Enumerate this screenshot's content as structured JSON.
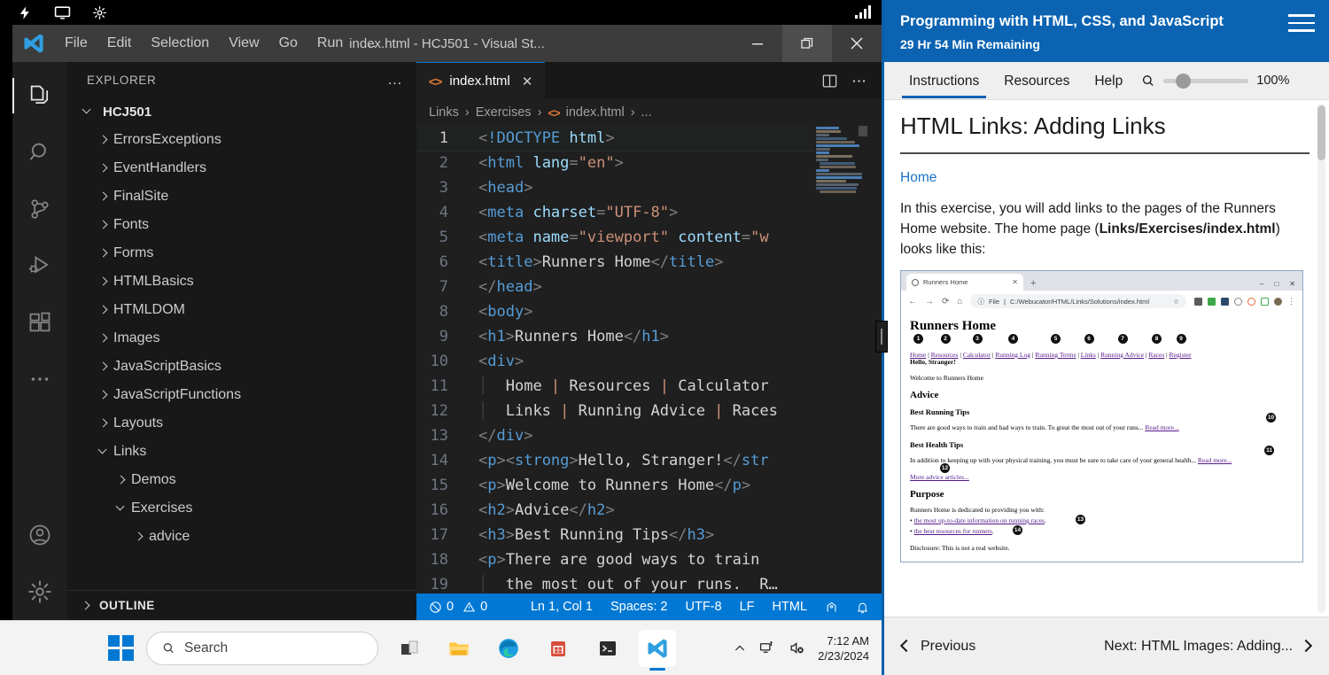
{
  "system_strip": {
    "icons": [
      "bolt-icon",
      "monitor-icon",
      "gear-icon",
      "signal-icon"
    ]
  },
  "vscode": {
    "window_title": "index.html - HCJ501 - Visual St...",
    "menu": [
      "File",
      "Edit",
      "Selection",
      "View",
      "Go",
      "Run",
      "…"
    ],
    "window_buttons": {
      "minimize": "—",
      "restore": "❐",
      "close": "✕"
    },
    "activity_bar": [
      {
        "name": "explorer-icon",
        "active": true
      },
      {
        "name": "search-icon",
        "active": false
      },
      {
        "name": "source-control-icon",
        "active": false
      },
      {
        "name": "run-debug-icon",
        "active": false
      },
      {
        "name": "extensions-icon",
        "active": false
      },
      {
        "name": "more-views-icon",
        "active": false
      },
      {
        "name": "account-icon",
        "active": false
      },
      {
        "name": "manage-settings-icon",
        "active": false
      }
    ],
    "sidebar": {
      "header": "EXPLORER",
      "header_actions": "…",
      "root": "HCJ501",
      "tree": [
        {
          "label": "ErrorsExceptions",
          "depth": 1,
          "expanded": false
        },
        {
          "label": "EventHandlers",
          "depth": 1,
          "expanded": false
        },
        {
          "label": "FinalSite",
          "depth": 1,
          "expanded": false
        },
        {
          "label": "Fonts",
          "depth": 1,
          "expanded": false
        },
        {
          "label": "Forms",
          "depth": 1,
          "expanded": false
        },
        {
          "label": "HTMLBasics",
          "depth": 1,
          "expanded": false
        },
        {
          "label": "HTMLDOM",
          "depth": 1,
          "expanded": false
        },
        {
          "label": "Images",
          "depth": 1,
          "expanded": false
        },
        {
          "label": "JavaScriptBasics",
          "depth": 1,
          "expanded": false
        },
        {
          "label": "JavaScriptFunctions",
          "depth": 1,
          "expanded": false
        },
        {
          "label": "Layouts",
          "depth": 1,
          "expanded": false
        },
        {
          "label": "Links",
          "depth": 1,
          "expanded": true
        },
        {
          "label": "Demos",
          "depth": 2,
          "expanded": false
        },
        {
          "label": "Exercises",
          "depth": 2,
          "expanded": true
        },
        {
          "label": "advice",
          "depth": 3,
          "expanded": false
        }
      ],
      "outline": "OUTLINE"
    },
    "editor": {
      "tab_label": "index.html",
      "tab_close": "✕",
      "tab_actions": [
        "split-editor-icon",
        "more-actions-icon"
      ],
      "breadcrumb": [
        "Links",
        "Exercises",
        "index.html",
        "..."
      ],
      "breadcrumb_separator": "›",
      "lines": [
        {
          "n": "1",
          "html": "<span class='t-punct'>&lt;</span><span class='t-doct'>!DOCTYPE </span><span class='t-docta'>html</span><span class='t-punct'>&gt;</span>"
        },
        {
          "n": "2",
          "html": "<span class='t-punct'>&lt;</span><span class='t-tag'>html</span> <span class='t-attr'>lang</span><span class='t-punct'>=</span><span class='t-str'>\"en\"</span><span class='t-punct'>&gt;</span>"
        },
        {
          "n": "3",
          "html": "<span class='t-punct'>&lt;</span><span class='t-tag'>head</span><span class='t-punct'>&gt;</span>"
        },
        {
          "n": "4",
          "html": "<span class='t-punct'>&lt;</span><span class='t-tag'>meta</span> <span class='t-attr'>charset</span><span class='t-punct'>=</span><span class='t-str'>\"UTF-8\"</span><span class='t-punct'>&gt;</span>"
        },
        {
          "n": "5",
          "html": "<span class='t-punct'>&lt;</span><span class='t-tag'>meta</span> <span class='t-attr'>name</span><span class='t-punct'>=</span><span class='t-str'>\"viewport\"</span> <span class='t-attr'>content</span><span class='t-punct'>=</span><span class='t-str'>\"w</span>"
        },
        {
          "n": "6",
          "html": "<span class='t-punct'>&lt;</span><span class='t-tag'>title</span><span class='t-punct'>&gt;</span><span class='t-txt'>Runners Home</span><span class='t-punct'>&lt;/</span><span class='t-tag'>title</span><span class='t-punct'>&gt;</span>"
        },
        {
          "n": "7",
          "html": "<span class='t-punct'>&lt;/</span><span class='t-tag'>head</span><span class='t-punct'>&gt;</span>"
        },
        {
          "n": "8",
          "html": "<span class='t-punct'>&lt;</span><span class='t-tag'>body</span><span class='t-punct'>&gt;</span>"
        },
        {
          "n": "9",
          "html": "<span class='t-punct'>&lt;</span><span class='t-tag'>h1</span><span class='t-punct'>&gt;</span><span class='t-txt'>Runners Home</span><span class='t-punct'>&lt;/</span><span class='t-tag'>h1</span><span class='t-punct'>&gt;</span>"
        },
        {
          "n": "10",
          "html": "<span class='t-punct'>&lt;</span><span class='t-tag'>div</span><span class='t-punct'>&gt;</span>"
        },
        {
          "n": "11",
          "html": "<span class='indent-guide'>│</span>  <span class='t-txt'>Home </span><span class='t-str'>|</span><span class='t-txt'> Resources </span><span class='t-str'>|</span><span class='t-txt'> Calculator</span>"
        },
        {
          "n": "12",
          "html": "<span class='indent-guide'>│</span>  <span class='t-txt'>Links </span><span class='t-str'>|</span><span class='t-txt'> Running Advice </span><span class='t-str'>|</span><span class='t-txt'> Races</span>"
        },
        {
          "n": "13",
          "html": "<span class='t-punct'>&lt;/</span><span class='t-tag'>div</span><span class='t-punct'>&gt;</span>"
        },
        {
          "n": "14",
          "html": "<span class='t-punct'>&lt;</span><span class='t-tag'>p</span><span class='t-punct'>&gt;&lt;</span><span class='t-tag'>strong</span><span class='t-punct'>&gt;</span><span class='t-txt'>Hello, Stranger!</span><span class='t-punct'>&lt;/</span><span class='t-tag'>str</span>"
        },
        {
          "n": "15",
          "html": "<span class='t-punct'>&lt;</span><span class='t-tag'>p</span><span class='t-punct'>&gt;</span><span class='t-txt'>Welcome to Runners Home</span><span class='t-punct'>&lt;/</span><span class='t-tag'>p</span><span class='t-punct'>&gt;</span>"
        },
        {
          "n": "16",
          "html": "<span class='t-punct'>&lt;</span><span class='t-tag'>h2</span><span class='t-punct'>&gt;</span><span class='t-txt'>Advice</span><span class='t-punct'>&lt;/</span><span class='t-tag'>h2</span><span class='t-punct'>&gt;</span>"
        },
        {
          "n": "17",
          "html": "<span class='t-punct'>&lt;</span><span class='t-tag'>h3</span><span class='t-punct'>&gt;</span><span class='t-txt'>Best Running Tips</span><span class='t-punct'>&lt;/</span><span class='t-tag'>h3</span><span class='t-punct'>&gt;</span>"
        },
        {
          "n": "18",
          "html": "<span class='t-punct'>&lt;</span><span class='t-tag'>p</span><span class='t-punct'>&gt;</span><span class='t-txt'>There are good ways to train</span>"
        },
        {
          "n": "19",
          "html": "<span class='indent-guide'>│</span>  <span class='t-txt'>the most out of your runs.  R…</span>"
        }
      ]
    },
    "status_bar": {
      "errors": "0",
      "warnings": "0",
      "position": "Ln 1, Col 1",
      "spaces": "Spaces: 2",
      "encoding": "UTF-8",
      "eol": "LF",
      "language": "HTML",
      "right_icons": [
        "remote-icon",
        "bell-icon"
      ]
    }
  },
  "taskbar": {
    "search_placeholder": "Search",
    "apps": [
      "start-icon",
      "task-view-icon",
      "file-explorer-icon",
      "edge-icon",
      "microsoft-store-icon",
      "terminal-icon",
      "vscode-icon"
    ],
    "tray_icons": [
      "show-hidden-icons-icon",
      "network-icon",
      "volume-muted-icon"
    ],
    "time": "7:12 AM",
    "date": "2/23/2024"
  },
  "course_panel": {
    "title": "Programming with HTML, CSS, and JavaScript",
    "time_remaining": "29 Hr 54 Min Remaining",
    "menu_icon": "hamburger-menu-icon",
    "tabs": [
      {
        "label": "Instructions",
        "active": true
      },
      {
        "label": "Resources",
        "active": false
      },
      {
        "label": "Help",
        "active": false
      }
    ],
    "zoom": {
      "icon": "search-icon",
      "percent": "100%"
    },
    "doc": {
      "heading": "HTML Links: Adding Links",
      "link": "Home",
      "paragraph_1": "In this exercise, you will add links to the pages of the Runners Home website. The home page (",
      "paragraph_1_bold": "Links/Exercises/index.html",
      "paragraph_1_end": ") looks like this:"
    },
    "embedded_browser": {
      "tab_title": "Runners Home",
      "new_tab": "+",
      "window_buttons": [
        "minimize",
        "maximize",
        "close"
      ],
      "nav_icons": [
        "back-icon",
        "forward-icon",
        "reload-icon",
        "home-icon"
      ],
      "url_prefix": "File",
      "url": "C:/Webucator/HTML/Links/Solutions/index.html",
      "omnibox_icons": [
        "star-icon",
        "extensions",
        "profile-icon",
        "more-menu-icon"
      ],
      "page": {
        "h1": "Runners Home",
        "nav_links": [
          "Home",
          "Resources",
          "Calculator",
          "Running Log",
          "Running Terms",
          "Links",
          "Running Advice",
          "Races",
          "Register"
        ],
        "nav_badges": [
          "1",
          "2",
          "3",
          "4",
          "5",
          "6",
          "7",
          "8",
          "9"
        ],
        "greeting": "Hello, Stranger!",
        "welcome": "Welcome to Runners Home",
        "h2_advice": "Advice",
        "h3_running": "Best Running Tips",
        "p_running": "There are good ways to train and bad ways to train. To great the most out of your runs...",
        "read_more_1": "Read more...",
        "badge_10": "10",
        "h3_health": "Best Health Tips",
        "p_health": "In addition to keeping up with your physical training, you must be sure to take care of your general health...",
        "read_more_2": "Read more...",
        "badge_11": "11",
        "more_articles": "More advice articles...",
        "badge_12": "12",
        "h2_purpose": "Purpose",
        "p_purpose": "Runners Home is dedicated to providing you with:",
        "bullet_1": "the most up-to-date information on running races",
        "badge_13": "13",
        "bullet_2": "the best resources for runners",
        "badge_14": "14",
        "disclosure": "Disclosure: This is not a real website."
      }
    },
    "footer": {
      "previous": "Previous",
      "next": "Next: HTML Images: Adding..."
    }
  }
}
